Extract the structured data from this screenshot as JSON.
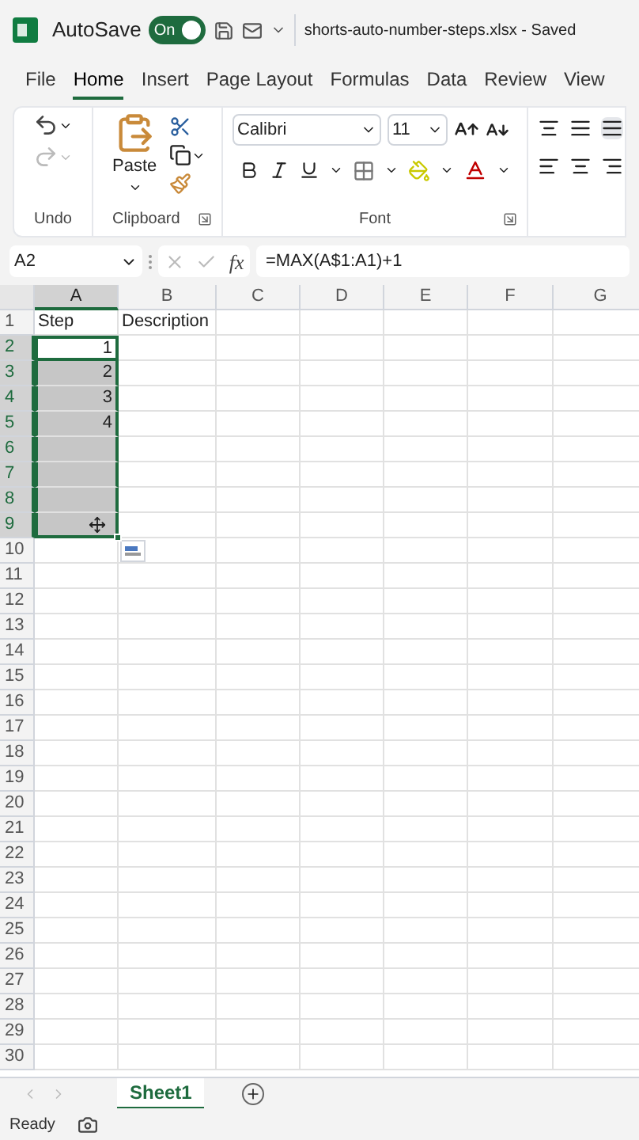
{
  "title_bar": {
    "autosave_label": "AutoSave",
    "autosave": {
      "on": true,
      "label": "On"
    },
    "filename": "shorts-auto-number-steps.xlsx",
    "separator": "-",
    "status": "Saved"
  },
  "menu_tabs": [
    {
      "label": "File",
      "selected": false
    },
    {
      "label": "Home",
      "selected": true
    },
    {
      "label": "Insert",
      "selected": false
    },
    {
      "label": "Page Layout",
      "selected": false
    },
    {
      "label": "Formulas",
      "selected": false
    },
    {
      "label": "Data",
      "selected": false
    },
    {
      "label": "Review",
      "selected": false
    },
    {
      "label": "View",
      "selected": false
    }
  ],
  "ribbon": {
    "undo_label": "Undo",
    "paste_label": "Paste",
    "clipboard_label": "Clipboard",
    "font_name": "Calibri",
    "font_size": "11",
    "font_label": "Font"
  },
  "formula_bar": {
    "name_box": "A2",
    "function_label": "fx",
    "formula": "=MAX(A$1:A1)+1"
  },
  "grid": {
    "columns": [
      {
        "label": "A",
        "selected": true
      },
      {
        "label": "B",
        "selected": false
      },
      {
        "label": "C",
        "selected": false
      },
      {
        "label": "D",
        "selected": false
      },
      {
        "label": "E",
        "selected": false
      },
      {
        "label": "F",
        "selected": false
      },
      {
        "label": "G",
        "selected": false
      }
    ],
    "rows": [
      {
        "number": "1",
        "selected": false,
        "active": false,
        "cells": [
          "Step",
          "Description"
        ]
      },
      {
        "number": "2",
        "selected": true,
        "active": true,
        "cells": [
          "1"
        ]
      },
      {
        "number": "3",
        "selected": true,
        "active": false,
        "cells": [
          "2"
        ]
      },
      {
        "number": "4",
        "selected": true,
        "active": false,
        "cells": [
          "3"
        ]
      },
      {
        "number": "5",
        "selected": true,
        "active": false,
        "cells": [
          "4"
        ]
      },
      {
        "number": "6",
        "selected": true,
        "active": false,
        "cells": []
      },
      {
        "number": "7",
        "selected": true,
        "active": false,
        "cells": []
      },
      {
        "number": "8",
        "selected": true,
        "active": false,
        "cells": []
      },
      {
        "number": "9",
        "selected": true,
        "active": false,
        "cells": []
      },
      {
        "number": "10",
        "selected": false,
        "active": false,
        "cells": []
      },
      {
        "number": "11",
        "selected": false,
        "active": false,
        "cells": []
      },
      {
        "number": "12",
        "selected": false,
        "active": false,
        "cells": []
      },
      {
        "number": "13",
        "selected": false,
        "active": false,
        "cells": []
      },
      {
        "number": "14",
        "selected": false,
        "active": false,
        "cells": []
      },
      {
        "number": "15",
        "selected": false,
        "active": false,
        "cells": []
      },
      {
        "number": "16",
        "selected": false,
        "active": false,
        "cells": []
      },
      {
        "number": "17",
        "selected": false,
        "active": false,
        "cells": []
      },
      {
        "number": "18",
        "selected": false,
        "active": false,
        "cells": []
      },
      {
        "number": "19",
        "selected": false,
        "active": false,
        "cells": []
      },
      {
        "number": "20",
        "selected": false,
        "active": false,
        "cells": []
      },
      {
        "number": "21",
        "selected": false,
        "active": false,
        "cells": []
      },
      {
        "number": "22",
        "selected": false,
        "active": false,
        "cells": []
      },
      {
        "number": "23",
        "selected": false,
        "active": false,
        "cells": []
      },
      {
        "number": "24",
        "selected": false,
        "active": false,
        "cells": []
      },
      {
        "number": "25",
        "selected": false,
        "active": false,
        "cells": []
      },
      {
        "number": "26",
        "selected": false,
        "active": false,
        "cells": []
      },
      {
        "number": "27",
        "selected": false,
        "active": false,
        "cells": []
      },
      {
        "number": "28",
        "selected": false,
        "active": false,
        "cells": []
      },
      {
        "number": "29",
        "selected": false,
        "active": false,
        "cells": []
      },
      {
        "number": "30",
        "selected": false,
        "active": false,
        "cells": []
      }
    ]
  },
  "sheet_tabs": [
    {
      "label": "Sheet1",
      "selected": true
    }
  ],
  "status_bar": {
    "status": "Ready"
  }
}
